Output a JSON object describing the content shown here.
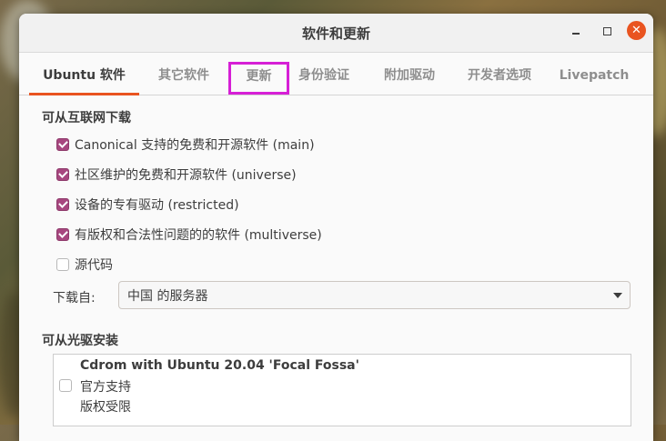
{
  "window": {
    "title": "软件和更新"
  },
  "tabs": [
    {
      "label": "Ubuntu 软件",
      "active": true
    },
    {
      "label": "其它软件",
      "active": false
    },
    {
      "label": "更新",
      "active": false,
      "highlighted": true
    },
    {
      "label": "身份验证",
      "active": false
    },
    {
      "label": "附加驱动",
      "active": false
    },
    {
      "label": "开发者选项",
      "active": false
    },
    {
      "label": "Livepatch",
      "active": false
    }
  ],
  "internet": {
    "heading": "可从互联网下载",
    "options": [
      {
        "label": "Canonical 支持的免费和开源软件 (main)",
        "checked": true
      },
      {
        "label": "社区维护的免费和开源软件 (universe)",
        "checked": true
      },
      {
        "label": "设备的专有驱动 (restricted)",
        "checked": true
      },
      {
        "label": "有版权和合法性问题的的软件 (multiverse)",
        "checked": true
      },
      {
        "label": "源代码",
        "checked": false
      }
    ],
    "download_from_label": "下载自:",
    "server_selected": "中国 的服务器"
  },
  "cdrom": {
    "heading": "可从光驱安装",
    "item": {
      "name": "Cdrom with Ubuntu 20.04 'Focal Fossa'",
      "line2": "官方支持",
      "line3": "版权受限",
      "checked": false
    }
  },
  "colors": {
    "accent": "#e95420",
    "checkbox": "#a7477f",
    "highlight": "#d61fd6"
  }
}
